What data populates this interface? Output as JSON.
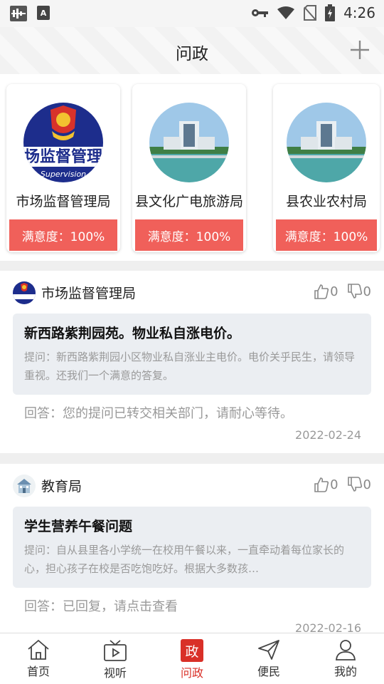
{
  "status_bar": {
    "time": "4:26",
    "left_icons": [
      "signal-grid-icon",
      "text-a-icon"
    ],
    "right_icons": [
      "key-icon",
      "wifi-icon",
      "sim-off-icon",
      "battery-charging-icon"
    ]
  },
  "header": {
    "title": "问政",
    "add_icon": "plus-icon"
  },
  "departments": [
    {
      "name": "市场监督管理局",
      "satisfaction": "满意度：100%",
      "logo_text": "场监督管理",
      "logo_subtext": "Supervision"
    },
    {
      "name": "县文化广电旅游局",
      "satisfaction": "满意度：100%"
    },
    {
      "name": "县农业农村局",
      "satisfaction": "满意度：100%"
    }
  ],
  "posts": [
    {
      "dept": "市场监督管理局",
      "likes": "0",
      "dislikes": "0",
      "title": "新西路紫荆园苑。物业私自涨电价。",
      "body": "提问：新西路紫荆园小区物业私自涨业主电价。电价关乎民生，请领导重视。还我们一个满意的答复。",
      "answer": "回答：您的提问已转交相关部门，请耐心等待。",
      "date": "2022-02-24"
    },
    {
      "dept": "教育局",
      "likes": "0",
      "dislikes": "0",
      "title": "学生营养午餐问题",
      "body": "提问：自从县里各小学统一在校用午餐以来，一直牵动着每位家长的心，担心孩子在校是否吃饱吃好。根据大多数孩…",
      "answer": "回答：已回复，请点击查看",
      "date": "2022-02-16"
    }
  ],
  "nav": [
    {
      "label": "首页",
      "icon": "home-icon"
    },
    {
      "label": "视听",
      "icon": "tv-play-icon"
    },
    {
      "label": "问政",
      "icon": "gov-icon",
      "icon_text": "政",
      "active": true
    },
    {
      "label": "便民",
      "icon": "paper-plane-icon"
    },
    {
      "label": "我的",
      "icon": "user-icon"
    }
  ],
  "colors": {
    "accent": "#d93028",
    "badge": "#f0605a",
    "question_bg": "#ebeef2"
  }
}
